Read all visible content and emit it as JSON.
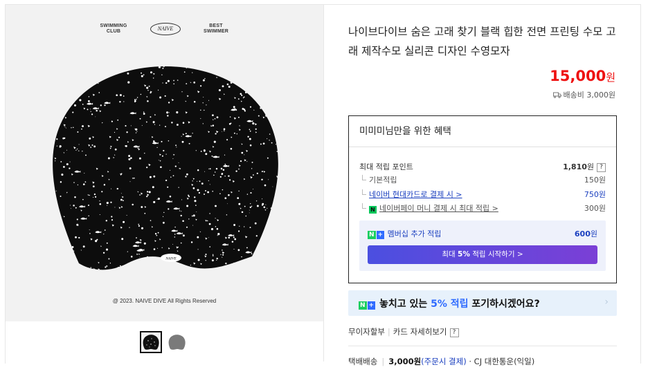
{
  "gallery": {
    "brand_left_1": "SWIMMING",
    "brand_left_2": "CLUB",
    "brand_center": "NAIVE",
    "brand_right_1": "BEST",
    "brand_right_2": "SWIMMER",
    "cap_logo": "NAIVE",
    "copyright": "@ 2023. NAIVE DIVE All Rights Reserved",
    "thumbnails": [
      "black",
      "gray"
    ]
  },
  "product": {
    "title": "나이브다이브 숨은 고래 찾기 블랙 힙한 전면 프린팅 수모 고래 제작수모 실리콘 디자인 수영모자",
    "price": "15,000",
    "price_unit": "원",
    "shipping": "배송비 3,000원"
  },
  "benefit": {
    "heading": "미미미님만을 위한 혜택",
    "max_points_label": "최대 적립 포인트",
    "max_points_value": "1,810",
    "won": "원",
    "help": "?",
    "basic_label": "기본적립",
    "basic_value": "150원",
    "card_label": "네이버 현대카드로 결제 시 >",
    "card_value": "750원",
    "npay_label": "네이버페이 머니 결제 시 최대 적립 >",
    "npay_value": "300원",
    "npay_icon": "N",
    "membership_label": "멤버십 추가 적립",
    "membership_value": "600",
    "membership_won": "원",
    "cta_pre": "최대 ",
    "cta_bold": "5%",
    "cta_post": " 적립 시작하기 >"
  },
  "banner": {
    "pre": "놓치고 있는 ",
    "highlight": "5% 적립",
    "post": " 포기하시겠어요?",
    "arrow": "›"
  },
  "badges": {
    "n": "N",
    "plus": "+"
  },
  "payment": {
    "installment": "무이자할부",
    "card_detail": "카드 자세히보기",
    "help": "?"
  },
  "delivery": {
    "label": "택배배송",
    "fee": "3,000원",
    "fee_note": "(주문시 결제)",
    "courier": "· CJ 대한통운(익일)"
  },
  "colors": {
    "price": "#ee1111",
    "accent_blue": "#2f6bff",
    "cta_start": "#4b4fe0",
    "cta_end": "#7b3fd6",
    "npay_green": "#03c75a"
  }
}
